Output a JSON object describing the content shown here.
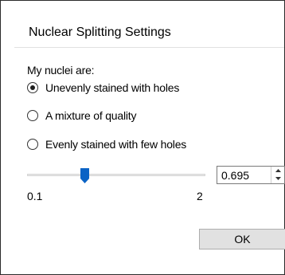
{
  "dialog": {
    "title": "Nuclear Splitting Settings"
  },
  "prompt": "My nuclei are:",
  "options": [
    {
      "label": "Unevenly stained with holes",
      "checked": true
    },
    {
      "label": "A mixture of quality",
      "checked": false
    },
    {
      "label": "Evenly stained with few holes",
      "checked": false
    }
  ],
  "slider": {
    "min_label": "0.1",
    "max_label": "2",
    "min": 0.1,
    "max": 2,
    "value": 0.695
  },
  "spinbox": {
    "value": "0.695"
  },
  "buttons": {
    "ok_label": "OK"
  },
  "colors": {
    "slider_thumb": "#0b63c5",
    "selected_dot": "#1e1e1e"
  },
  "icons": {
    "spin_up": "triangle-up-icon",
    "spin_down": "triangle-down-icon"
  }
}
